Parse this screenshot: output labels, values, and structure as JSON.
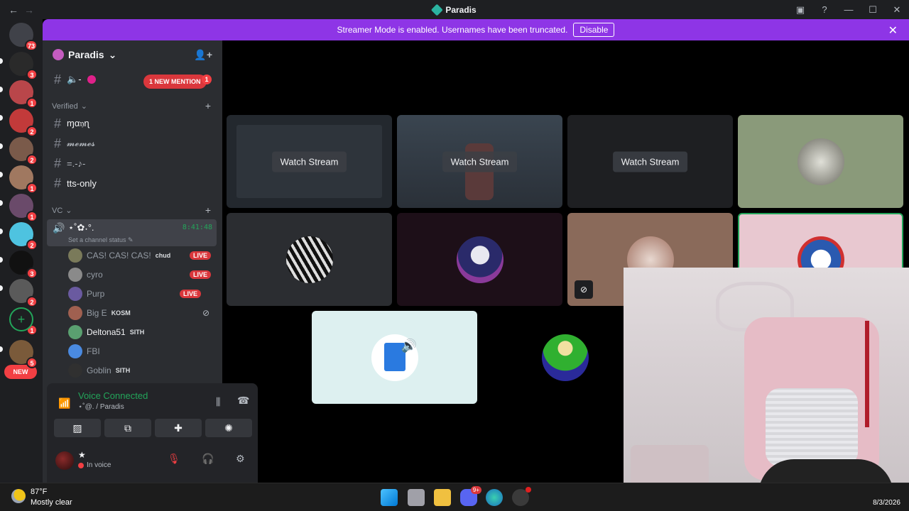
{
  "titlebar": {
    "back": "←",
    "forward": "→",
    "title": "Paradis",
    "icons": [
      "inbox-icon",
      "help-icon",
      "minimize-icon",
      "maximize-icon",
      "close-icon"
    ],
    "icon_glyphs": [
      "▣",
      "?",
      "—",
      "☐",
      "✕"
    ]
  },
  "banner": {
    "text": "Streamer Mode is enabled. Usernames have been truncated.",
    "button": "Disable",
    "close": "✕"
  },
  "rail": {
    "servers": [
      {
        "badge": "73",
        "color": "#404249"
      },
      {
        "badge": "3",
        "color": "#2a2a2a"
      },
      {
        "badge": "1",
        "color": "#b9464a"
      },
      {
        "badge": "2",
        "color": "#c23a3a"
      },
      {
        "badge": "2",
        "color": "#7a5a4a"
      },
      {
        "badge": "1",
        "color": "#a07860"
      },
      {
        "badge": "1",
        "color": "#6a4a6a"
      },
      {
        "badge": "2",
        "color": "#4ec3e0"
      },
      {
        "badge": "3",
        "color": "#111111"
      },
      {
        "badge": "2",
        "color": "#5a5a5a"
      },
      {
        "badge": "1",
        "color": "#1e1f22"
      },
      {
        "badge": "5",
        "color": "#7a5a3a"
      }
    ],
    "new_label": "NEW"
  },
  "server": {
    "name": "Paradis",
    "chevron": "⌄"
  },
  "channels": {
    "top_channel": "🔈-",
    "mention_label": "1 NEW MENTION",
    "top_unread": "1",
    "verified_category": "Verified",
    "verified_channels": [
      "ɱα𝔶ɳ",
      "𝓶𝓮𝓶𝓮𝓼",
      "=.-♪-"
    ],
    "tts_channel": "tts-only",
    "vc_category": "VC",
    "vc_name": "⋆˚✿˖°.",
    "vc_time": "8:41:48",
    "vc_status": "Set a channel status ✎"
  },
  "members": [
    {
      "name": "CAS! CAS! CAS!",
      "tag": "chud",
      "live": "LIVE",
      "color": "#7a7a5a"
    },
    {
      "name": "cyro",
      "tag": "",
      "live": "LIVE",
      "color": "#8a8a8a"
    },
    {
      "name": "Purp",
      "tag": "",
      "live": "LIVE",
      "color": "#6a5aa0"
    },
    {
      "name": "Big E",
      "tag": "KOSM",
      "live": "",
      "color": "#a06050"
    },
    {
      "name": "Deltona51",
      "tag": "SITH",
      "live": "",
      "color": "#5aa070"
    },
    {
      "name": "FBI",
      "tag": "",
      "live": "",
      "color": "#4a8ae0"
    },
    {
      "name": "Goblin",
      "tag": "SITH",
      "live": "",
      "color": "#303030"
    }
  ],
  "voice_panel": {
    "title": "Voice Connected",
    "subtitle": "⋆˚@. / Paradis",
    "buttons": [
      "video-off-icon",
      "screen-share-icon",
      "activities-icon",
      "soundboard-icon"
    ],
    "button_glyphs": [
      "▨",
      "⧉",
      "✚",
      "✺"
    ]
  },
  "user": {
    "name": "★",
    "status": "In voice",
    "mic": "🎙",
    "headphones": "🎧",
    "settings": "⚙"
  },
  "stage": {
    "watch_label": "Watch Stream"
  },
  "taskbar": {
    "temp": "87°F",
    "condition": "Mostly clear",
    "discord_badge": "9+",
    "date": "8/3/2026"
  },
  "colors": {
    "banner": "#8e35e6",
    "green": "#23a55a",
    "red": "#da373c"
  }
}
